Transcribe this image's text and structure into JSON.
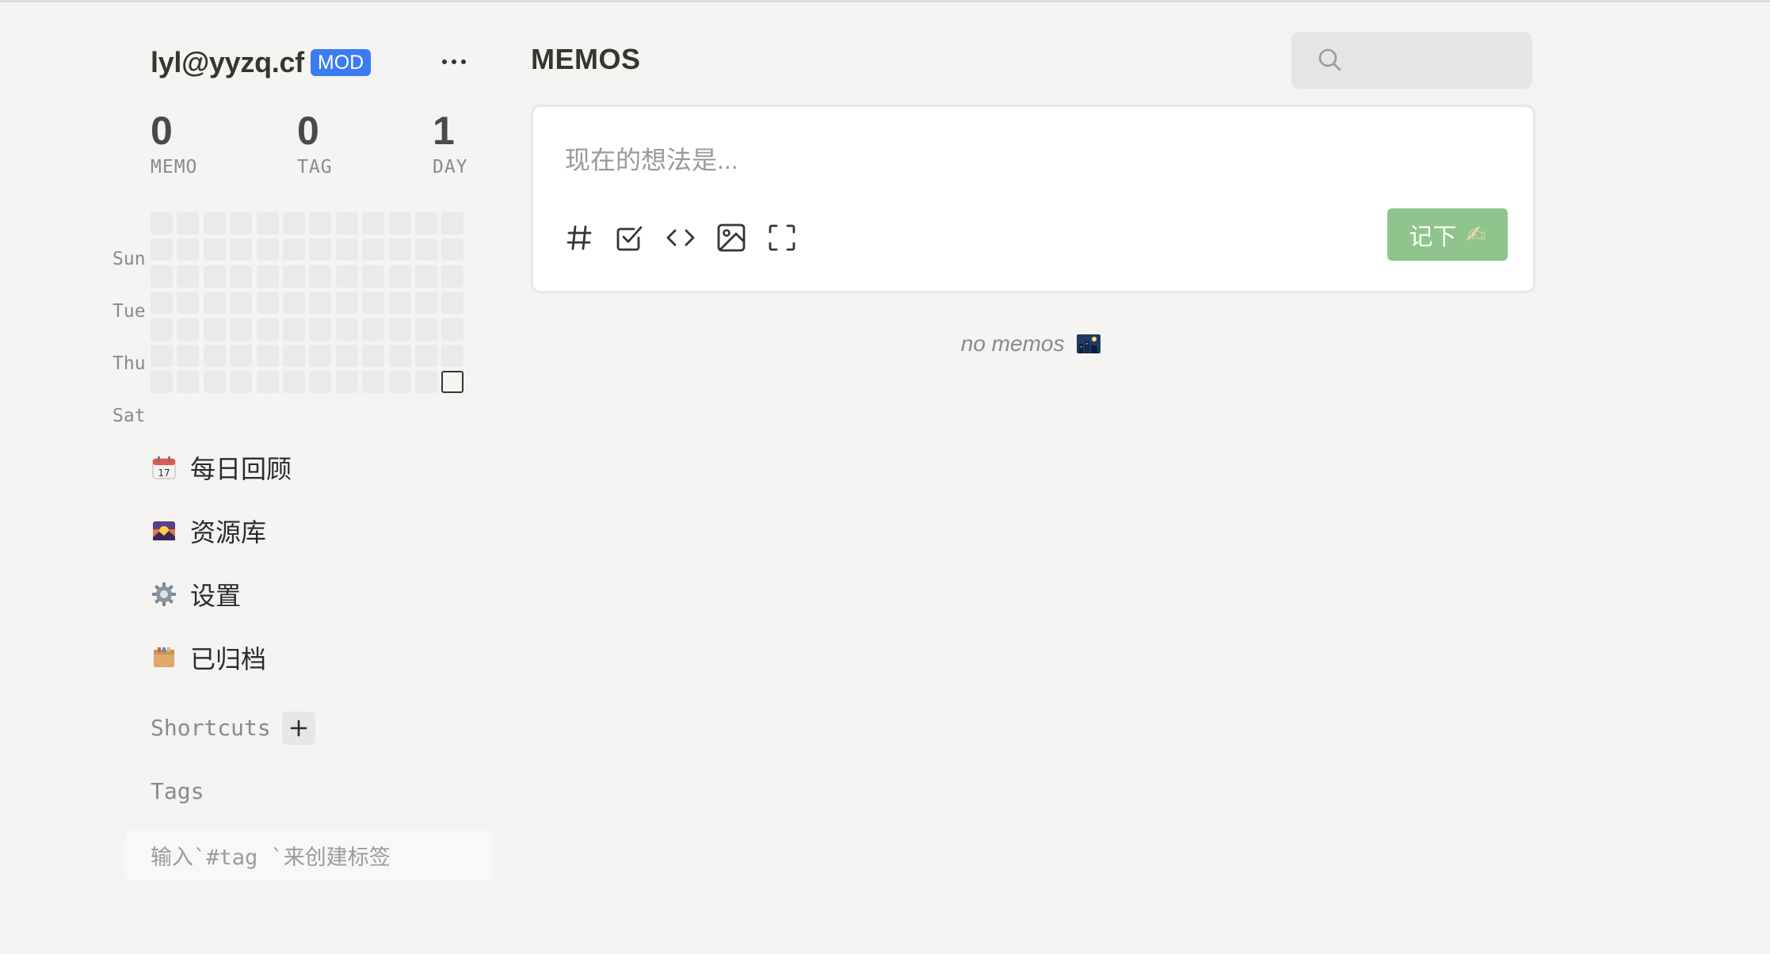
{
  "user": {
    "name": "lyl@yyzq.cf",
    "role": "MOD"
  },
  "stats": [
    {
      "value": "0",
      "label": "MEMO"
    },
    {
      "value": "0",
      "label": "TAG"
    },
    {
      "value": "1",
      "label": "DAY"
    }
  ],
  "heatmap": {
    "weekday_labels": [
      "Sun",
      "Tue",
      "Thu",
      "Sat"
    ],
    "weeks": 12,
    "today_marker": "last-saturday"
  },
  "nav": [
    {
      "label": "每日回顾",
      "icon": "calendar-icon"
    },
    {
      "label": "资源库",
      "icon": "sunset-image-icon"
    },
    {
      "label": "设置",
      "icon": "gear-icon"
    },
    {
      "label": "已归档",
      "icon": "archive-box-icon"
    }
  ],
  "shortcuts": {
    "title": "Shortcuts",
    "add_icon": "plus-icon"
  },
  "tags": {
    "title": "Tags",
    "hint": "输入`#tag `来创建标签"
  },
  "header": {
    "title": "MEMOS",
    "search_placeholder": ""
  },
  "editor": {
    "placeholder": "现在的想法是...",
    "tools": [
      "hash-icon",
      "checkbox-icon",
      "code-icon",
      "image-icon",
      "fullscreen-icon"
    ],
    "save_label": "记下",
    "save_emoji": "✍"
  },
  "empty_state": {
    "text": "no memos"
  },
  "colors": {
    "background": "#f5f4f2",
    "accent_badge": "#3b7cf5",
    "save_button": "#8fc58c",
    "heat_cell": "#eaeaea"
  }
}
